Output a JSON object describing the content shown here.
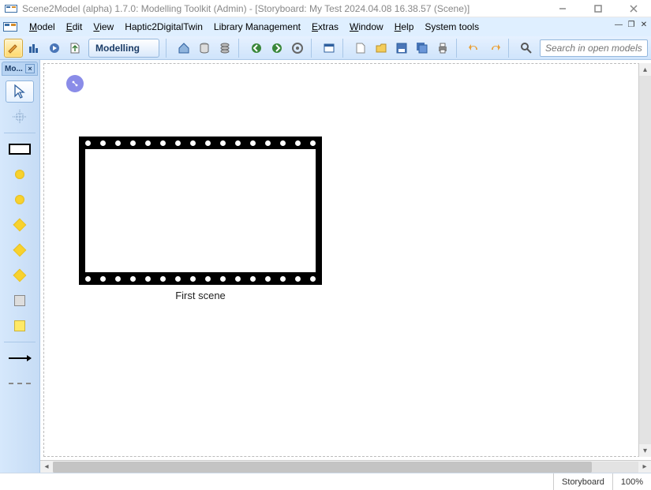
{
  "title": "Scene2Model (alpha) 1.7.0: Modelling Toolkit (Admin) - [Storyboard: My Test 2024.04.08 16.38.57 (Scene)]",
  "menu": {
    "model": "Model",
    "edit": "Edit",
    "view": "View",
    "haptic": "Haptic2DigitalTwin",
    "library": "Library Management",
    "extras": "Extras",
    "window": "Window",
    "help": "Help",
    "system": "System tools"
  },
  "toolbar": {
    "mode_label": "Modelling",
    "search_placeholder": "Search in open models"
  },
  "palette": {
    "tab_label": "Mo..."
  },
  "canvas": {
    "scene_label": "First scene"
  },
  "status": {
    "mode": "Storyboard",
    "zoom": "100%"
  }
}
